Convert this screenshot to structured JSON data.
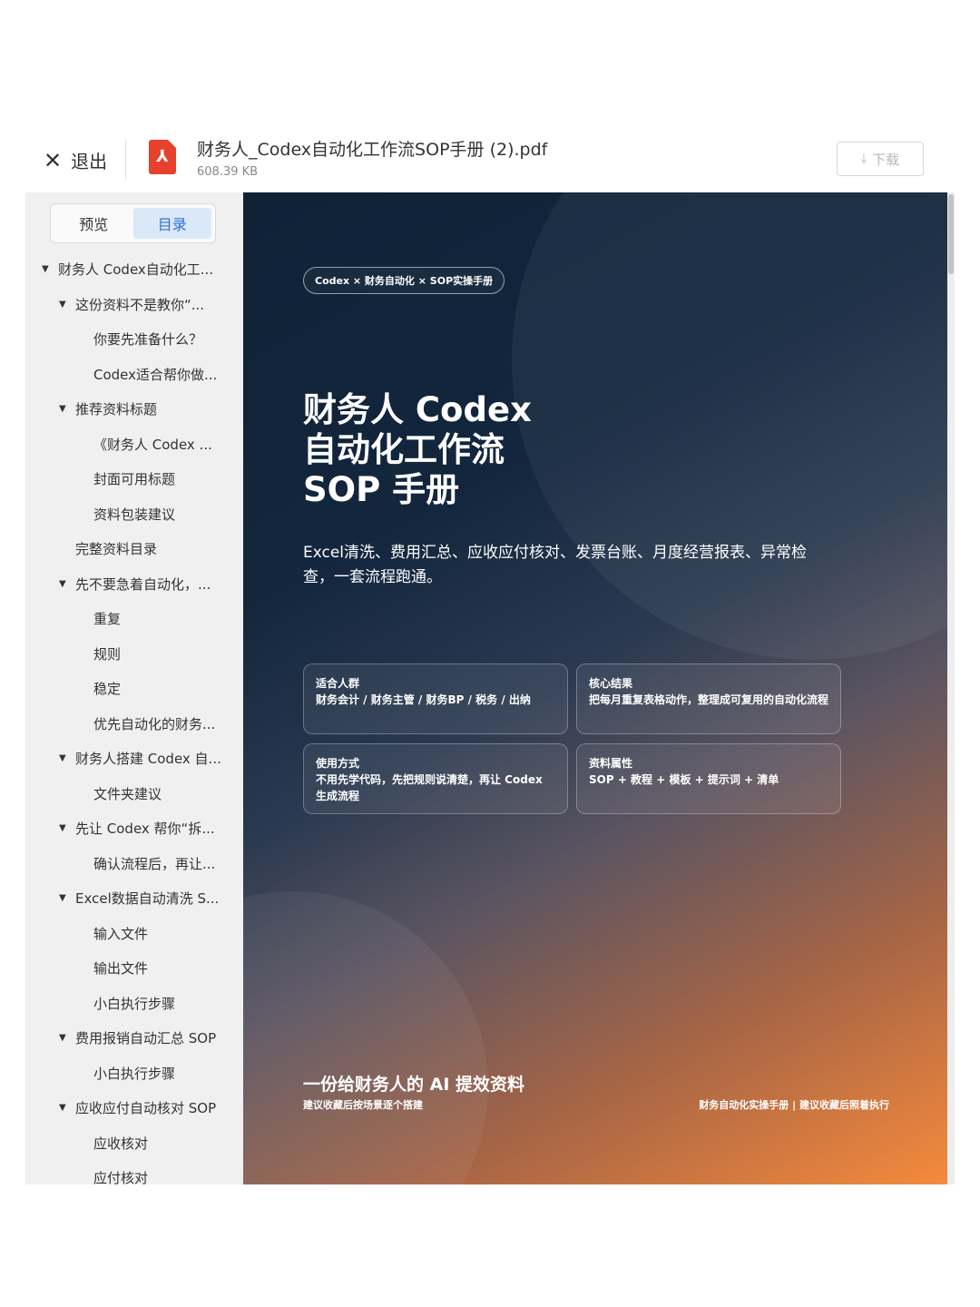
{
  "header": {
    "exit_label": "退出",
    "file_name": "财务人_Codex自动化工作流SOP手册 (2).pdf",
    "file_size": "608.39 KB",
    "download_label": "下载"
  },
  "sidebar": {
    "tabs": [
      {
        "label": "预览",
        "active": false
      },
      {
        "label": "目录",
        "active": true
      }
    ],
    "toc": [
      {
        "label": "财务人 Codex自动化工...",
        "level": 0,
        "expanded": true
      },
      {
        "label": "这份资料不是教你“...",
        "level": 1,
        "expanded": true
      },
      {
        "label": "你要先准备什么？",
        "level": 2
      },
      {
        "label": "Codex适合帮你做...",
        "level": 2
      },
      {
        "label": "推荐资料标题",
        "level": 1,
        "expanded": true
      },
      {
        "label": "《财务人 Codex ...",
        "level": 2
      },
      {
        "label": "封面可用标题",
        "level": 2
      },
      {
        "label": "资料包装建议",
        "level": 2
      },
      {
        "label": "完整资料目录",
        "level": 1,
        "expanded": null
      },
      {
        "label": "先不要急着自动化，...",
        "level": 1,
        "expanded": true
      },
      {
        "label": "重复",
        "level": 2
      },
      {
        "label": "规则",
        "level": 2
      },
      {
        "label": "稳定",
        "level": 2
      },
      {
        "label": "优先自动化的财务...",
        "level": 2
      },
      {
        "label": "财务人搭建 Codex 自...",
        "level": 1,
        "expanded": true
      },
      {
        "label": "文件夹建议",
        "level": 2
      },
      {
        "label": "先让 Codex 帮你“拆...",
        "level": 1,
        "expanded": true
      },
      {
        "label": "确认流程后，再让...",
        "level": 2
      },
      {
        "label": "Excel数据自动清洗 S...",
        "level": 1,
        "expanded": true
      },
      {
        "label": "输入文件",
        "level": 2
      },
      {
        "label": "输出文件",
        "level": 2
      },
      {
        "label": "小白执行步骤",
        "level": 2
      },
      {
        "label": "费用报销自动汇总 SOP",
        "level": 1,
        "expanded": true
      },
      {
        "label": "小白执行步骤",
        "level": 2
      },
      {
        "label": "应收应付自动核对 SOP",
        "level": 1,
        "expanded": true
      },
      {
        "label": "应收核对",
        "level": 2
      },
      {
        "label": "应付核对",
        "level": 2
      }
    ]
  },
  "cover": {
    "badge": "Codex × 财务自动化 × SOP实操手册",
    "title_lines": [
      "财务人 Codex",
      "自动化工作流",
      "SOP 手册"
    ],
    "subtitle": "Excel清洗、费用汇总、应收应付核对、发票台账、月度经营报表、异常检查，一套流程跑通。",
    "cards": [
      {
        "title": "适合人群",
        "body": "财务会计 / 财务主管 / 财务BP / 税务 / 出纳"
      },
      {
        "title": "核心结果",
        "body": "把每月重复表格动作，整理成可复用的自动化流程"
      },
      {
        "title": "使用方式",
        "body": "不用先学代码，先把规则说清楚，再让 Codex 生成流程"
      },
      {
        "title": "资料属性",
        "body": "SOP + 教程 + 模板 + 提示词 + 清单"
      }
    ],
    "footer_title": "一份给财务人的 AI 提效资料",
    "footer_sub": "建议收藏后按场景逐个搭建",
    "footer_right": "财务自动化实操手册 | 建议收藏后照着执行"
  }
}
